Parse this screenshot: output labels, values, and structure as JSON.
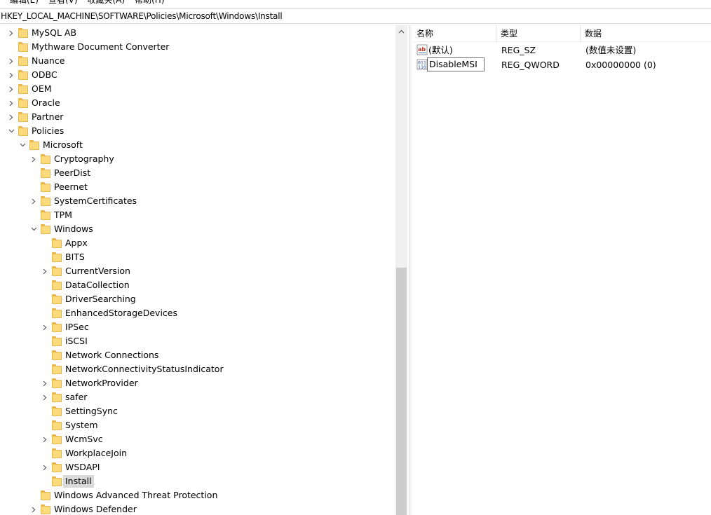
{
  "menu": [
    "编辑(E)",
    "查看(V)",
    "收藏夹(A)",
    "帮助(H)"
  ],
  "address": "HKEY_LOCAL_MACHINE\\SOFTWARE\\Policies\\Microsoft\\Windows\\Install",
  "tree": [
    {
      "label": "MySQL AB",
      "level": 0,
      "expander": "collapsed"
    },
    {
      "label": "Mythware Document Converter",
      "level": 0,
      "expander": "none"
    },
    {
      "label": "Nuance",
      "level": 0,
      "expander": "collapsed"
    },
    {
      "label": "ODBC",
      "level": 0,
      "expander": "collapsed"
    },
    {
      "label": "OEM",
      "level": 0,
      "expander": "collapsed"
    },
    {
      "label": "Oracle",
      "level": 0,
      "expander": "collapsed"
    },
    {
      "label": "Partner",
      "level": 0,
      "expander": "collapsed"
    },
    {
      "label": "Policies",
      "level": 0,
      "expander": "expanded"
    },
    {
      "label": "Microsoft",
      "level": 1,
      "expander": "expanded"
    },
    {
      "label": "Cryptography",
      "level": 2,
      "expander": "collapsed"
    },
    {
      "label": "PeerDist",
      "level": 2,
      "expander": "none"
    },
    {
      "label": "Peernet",
      "level": 2,
      "expander": "none"
    },
    {
      "label": "SystemCertificates",
      "level": 2,
      "expander": "collapsed"
    },
    {
      "label": "TPM",
      "level": 2,
      "expander": "none"
    },
    {
      "label": "Windows",
      "level": 2,
      "expander": "expanded"
    },
    {
      "label": "Appx",
      "level": 3,
      "expander": "none"
    },
    {
      "label": "BITS",
      "level": 3,
      "expander": "none"
    },
    {
      "label": "CurrentVersion",
      "level": 3,
      "expander": "collapsed"
    },
    {
      "label": "DataCollection",
      "level": 3,
      "expander": "none"
    },
    {
      "label": "DriverSearching",
      "level": 3,
      "expander": "none"
    },
    {
      "label": "EnhancedStorageDevices",
      "level": 3,
      "expander": "none"
    },
    {
      "label": "IPSec",
      "level": 3,
      "expander": "collapsed"
    },
    {
      "label": "iSCSI",
      "level": 3,
      "expander": "none"
    },
    {
      "label": "Network Connections",
      "level": 3,
      "expander": "none"
    },
    {
      "label": "NetworkConnectivityStatusIndicator",
      "level": 3,
      "expander": "none"
    },
    {
      "label": "NetworkProvider",
      "level": 3,
      "expander": "collapsed"
    },
    {
      "label": "safer",
      "level": 3,
      "expander": "collapsed"
    },
    {
      "label": "SettingSync",
      "level": 3,
      "expander": "none"
    },
    {
      "label": "System",
      "level": 3,
      "expander": "none"
    },
    {
      "label": "WcmSvc",
      "level": 3,
      "expander": "collapsed"
    },
    {
      "label": "WorkplaceJoin",
      "level": 3,
      "expander": "none"
    },
    {
      "label": "WSDAPI",
      "level": 3,
      "expander": "collapsed"
    },
    {
      "label": "Install",
      "level": 3,
      "expander": "none",
      "selected": true
    },
    {
      "label": "Windows Advanced Threat Protection",
      "level": 2,
      "expander": "none"
    },
    {
      "label": "Windows Defender",
      "level": 2,
      "expander": "collapsed"
    }
  ],
  "list": {
    "headers": {
      "name": "名称",
      "type": "类型",
      "data": "数据"
    },
    "rows": [
      {
        "name": "(默认)",
        "type": "REG_SZ",
        "data": "(数值未设置)",
        "icon": "string-value-icon"
      },
      {
        "name": "DisableMSI",
        "type": "REG_QWORD",
        "data": "0x00000000 (0)",
        "icon": "binary-value-icon",
        "editing": true
      }
    ]
  },
  "colors": {
    "folder": "#fcd97a",
    "folder_edge": "#e5b84c",
    "selection": "#d9d9d9"
  }
}
